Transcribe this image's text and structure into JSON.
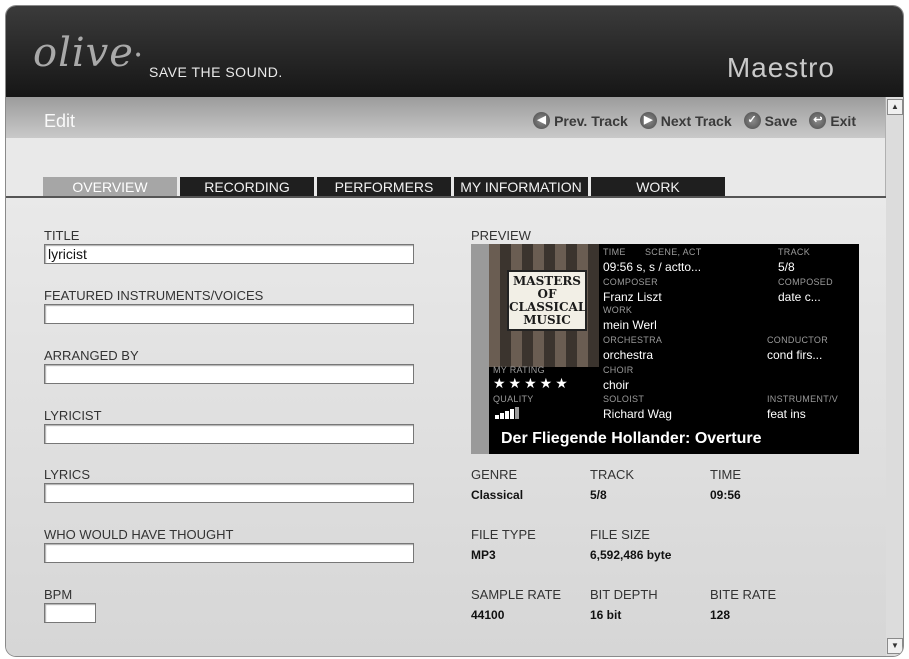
{
  "header": {
    "logo": "olive",
    "tagline": "SAVE THE SOUND.",
    "app_name": "Maestro"
  },
  "editbar": {
    "title": "Edit",
    "prev_label": "Prev. Track",
    "next_label": "Next Track",
    "save_label": "Save",
    "exit_label": "Exit"
  },
  "tabs": [
    {
      "label": "OVERVIEW",
      "active": true
    },
    {
      "label": "RECORDING",
      "active": false
    },
    {
      "label": "PERFORMERS",
      "active": false
    },
    {
      "label": "MY INFORMATION",
      "active": false
    },
    {
      "label": "WORK",
      "active": false
    }
  ],
  "form": {
    "title_label": "TITLE",
    "title_value": "lyricist",
    "featured_label": "FEATURED INSTRUMENTS/VOICES",
    "featured_value": "",
    "arranged_label": "ARRANGED BY",
    "arranged_value": "",
    "lyricist_label": "LYRICIST",
    "lyricist_value": "",
    "lyrics_label": "LYRICS",
    "lyrics_value": "",
    "wwht_label": "WHO WOULD HAVE THOUGHT",
    "wwht_value": "",
    "bpm_label": "BPM",
    "bpm_value": ""
  },
  "preview": {
    "label": "PREVIEW",
    "cover_text": [
      "MASTERS",
      "OF",
      "CLASSICAL",
      "MUSIC"
    ],
    "time_label": "TIME",
    "scene_label": "SCENE, ACT",
    "track_label": "TRACK",
    "time_scene_value": "09:56  s, s / actto...",
    "track_value": "5/8",
    "composer_label": "COMPOSER",
    "composed_label": "COMPOSED",
    "composer_value": "Franz Liszt",
    "composed_value": "date c...",
    "work_label": "WORK",
    "work_value": "mein Werl",
    "orchestra_label": "ORCHESTRA",
    "conductor_label": "CONDUCTOR",
    "orchestra_value": "orchestra",
    "conductor_value": "cond firs...",
    "rating_label": "MY RATING",
    "rating": 5,
    "choir_label": "CHOIR",
    "choir_value": "choir",
    "quality_label": "QUALITY",
    "soloist_label": "SOLOIST",
    "instrument_label": "INSTRUMENT/V",
    "soloist_value": "Richard Wag",
    "instrument_value": "feat ins",
    "song_title": "Der Fliegende Hollander: Overture"
  },
  "meta": {
    "genre_label": "GENRE",
    "genre_value": "Classical",
    "track_label": "TRACK",
    "track_value": "5/8",
    "time_label": "TIME",
    "time_value": "09:56",
    "filetype_label": "FILE TYPE",
    "filetype_value": "MP3",
    "filesize_label": "FILE SIZE",
    "filesize_value": "6,592,486 byte",
    "samplerate_label": "SAMPLE RATE",
    "samplerate_value": "44100",
    "bitdepth_label": "BIT DEPTH",
    "bitdepth_value": "16 bit",
    "biterate_label": "BITE RATE",
    "biterate_value": "128"
  }
}
